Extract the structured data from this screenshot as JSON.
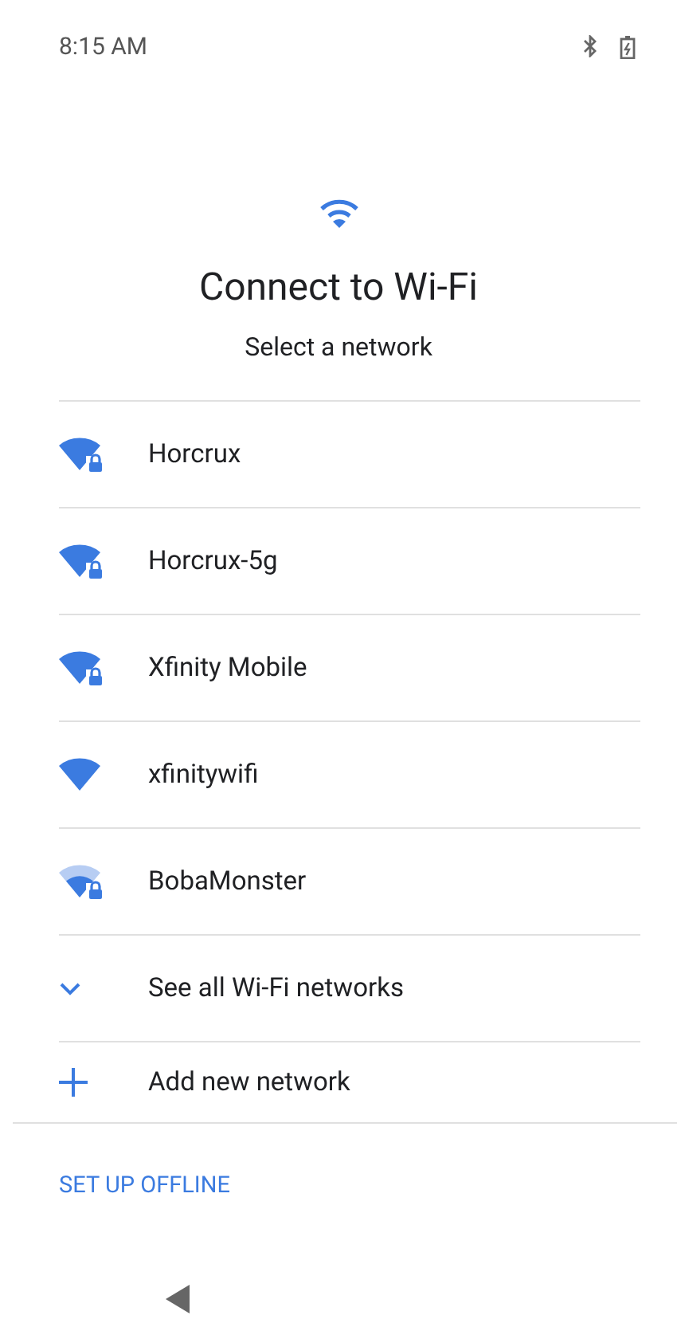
{
  "status_bar": {
    "time": "8:15 AM"
  },
  "header": {
    "title": "Connect to Wi-Fi",
    "subtitle": "Select a network"
  },
  "networks": [
    {
      "name": "Horcrux",
      "locked": true,
      "weak_signal": false
    },
    {
      "name": "Horcrux-5g",
      "locked": true,
      "weak_signal": false
    },
    {
      "name": "Xfinity Mobile",
      "locked": true,
      "weak_signal": false
    },
    {
      "name": "xfinitywifi",
      "locked": false,
      "weak_signal": false
    },
    {
      "name": "BobaMonster",
      "locked": true,
      "weak_signal": true
    }
  ],
  "actions": [
    {
      "kind": "expand",
      "label": "See all Wi-Fi networks"
    },
    {
      "kind": "add",
      "label": "Add new network"
    }
  ],
  "footer": {
    "button": "SET UP OFFLINE"
  }
}
